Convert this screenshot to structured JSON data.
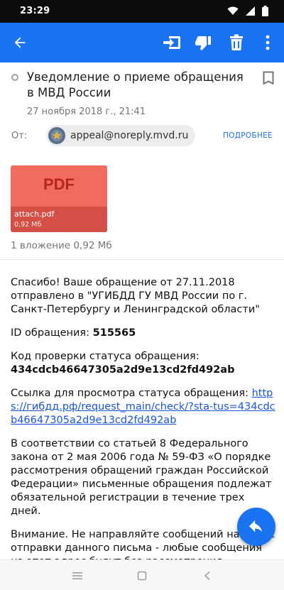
{
  "status_bar": {
    "time": "23:29",
    "icons": [
      "wifi-icon",
      "signal-icon",
      "battery-icon"
    ]
  },
  "toolbar": {
    "icons": [
      "back-arrow-icon",
      "move-to-folder-icon",
      "thumbs-down-icon",
      "trash-icon",
      "more-vert-icon"
    ],
    "color": "#1a73f0"
  },
  "message": {
    "subject": "Уведомление о приеме обращения в МВД России",
    "date": "27 ноября 2018 г., 21:41",
    "from_label": "От:",
    "from_email": "appeal@noreply.mvd.ru",
    "details_label": "ПОДРОБНЕЕ"
  },
  "attachment": {
    "type_label": "PDF",
    "name": "attach.pdf",
    "size": "0,92 Мб",
    "summary": "1 вложение 0,92 Мб",
    "color": "#f26b5e"
  },
  "body": {
    "p1": "Спасибо! Ваше обращение от 27.11.2018 отправлено в \"УГИБДД ГУ МВД России по г. Санкт-Петербургу и Ленинградской области\"",
    "id_label": "ID обращения: ",
    "id_value": "515565",
    "code_label": "Код проверки статуса обращения:",
    "code_value": "434cdcb46647305a2d9e13cd2fd492ab",
    "link_label": "Ссылка для просмотра статуса обращения: ",
    "link_url": "https://гибдд.рф/request_main/check/?sta-tus=434cdcb46647305a2d9e13cd2fd492ab",
    "p_law": "В соответствии со статьей 8 Федерального закона от 2 мая 2006 года № 59-ФЗ «О порядке рассмотрения обращений граждан Российской Федерации» письменные обращения подлежат обязательной регистрации в течение трех дней.",
    "p_warning": "Внимание. Не направляйте сообщений на адрес отправки данного письма - любые сообщения на этот адрес будут без рассмотрения автоматически удалены. Для повторного обращения вам необ-"
  },
  "fab": {
    "icon": "reply-icon"
  },
  "nav_bar": {
    "icons": [
      "menu-icon",
      "home-icon",
      "back-icon"
    ]
  }
}
